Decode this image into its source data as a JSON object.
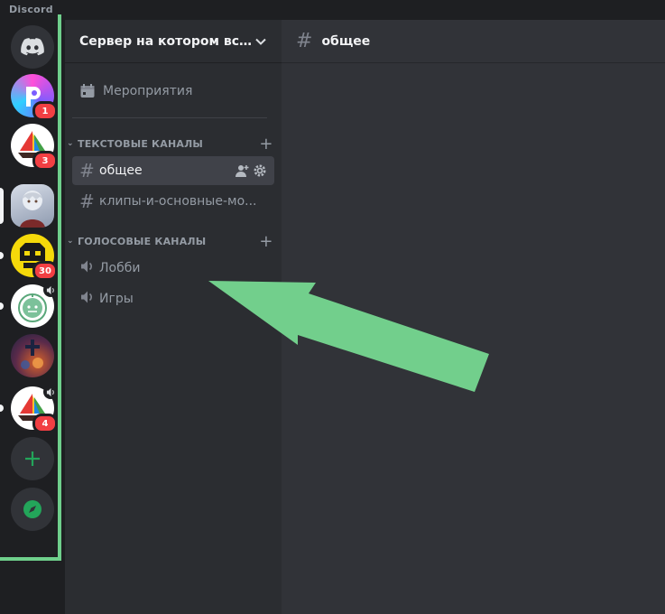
{
  "app": {
    "brand": "Discord"
  },
  "rail": {
    "servers": [
      {
        "name": "discord-home",
        "badge": ""
      },
      {
        "name": "server-p",
        "badge": "1"
      },
      {
        "name": "server-boat-1",
        "badge": "3"
      },
      {
        "name": "server-anime",
        "badge": ""
      },
      {
        "name": "server-yellow",
        "badge": "30"
      },
      {
        "name": "server-green-bot",
        "badge": ""
      },
      {
        "name": "server-art",
        "badge": ""
      },
      {
        "name": "server-boat-2",
        "badge": "4"
      }
    ]
  },
  "guild": {
    "name": "Сервер на котором все..."
  },
  "sidebar": {
    "events_label": "Мероприятия",
    "text_category": "ТЕКСТОВЫЕ КАНАЛЫ",
    "voice_category": "ГОЛОСОВЫЕ КАНАЛЫ",
    "text_channels": [
      "общее",
      "клипы-и-основные-мо..."
    ],
    "voice_channels": [
      "Лобби",
      "Игры"
    ]
  },
  "main": {
    "channel_title": "общее"
  },
  "colors": {
    "highlight": "#6fcf8c",
    "badge": "#f23f43",
    "add_server_green": "#23a55a"
  }
}
